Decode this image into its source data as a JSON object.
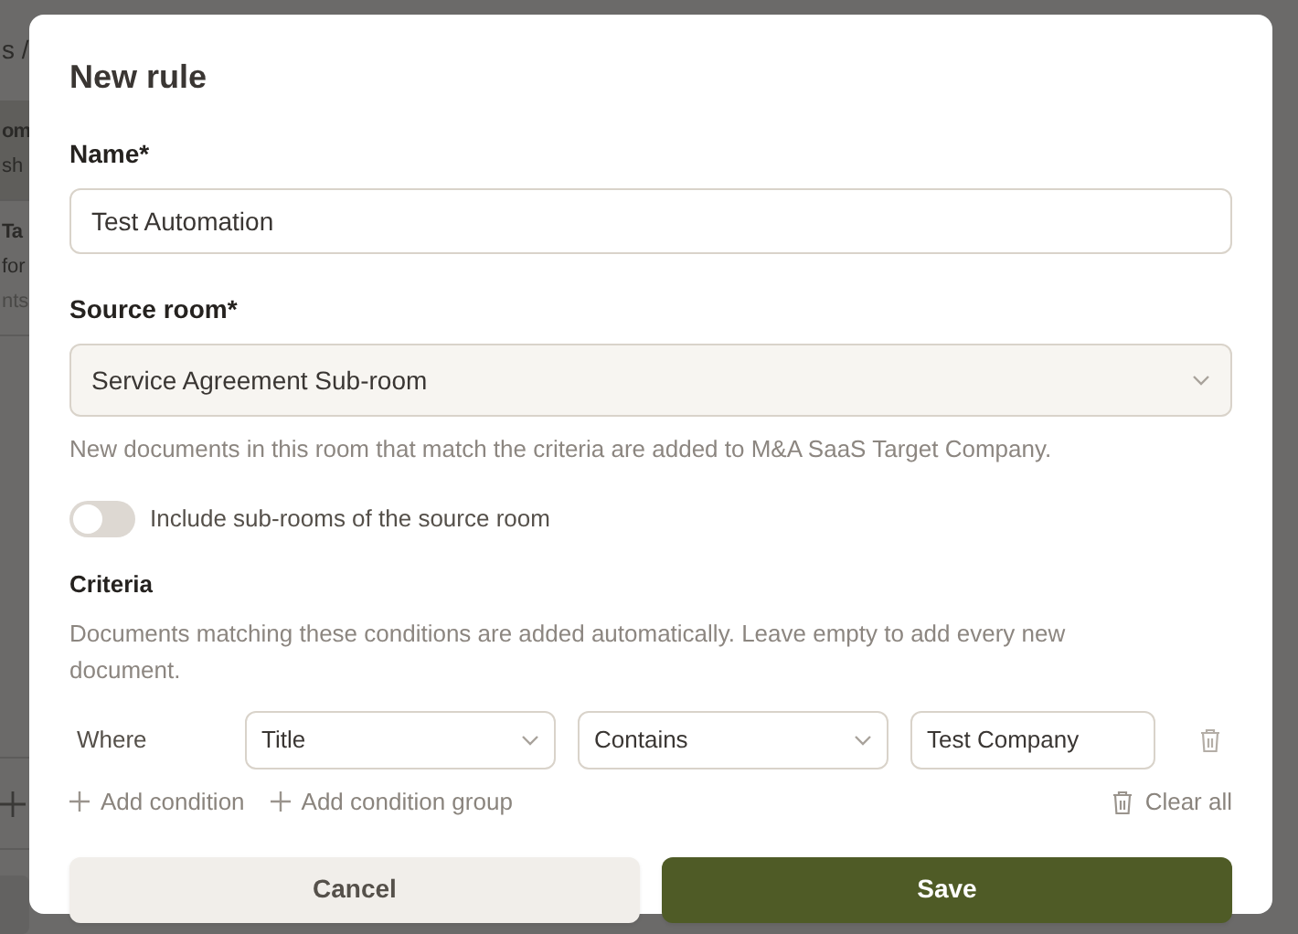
{
  "background": {
    "breadcrumb": "s /",
    "items": [
      {
        "title": "om",
        "subtitle": "sh",
        "selected": true
      },
      {
        "title": "Ta",
        "subtitle": "for",
        "meta": "nts",
        "selected": false
      }
    ]
  },
  "dialog": {
    "title": "New rule",
    "fields": [
      {
        "kind": "text",
        "label": "Name*",
        "value": "Test Automation"
      },
      {
        "kind": "select",
        "label": "Source room*",
        "value": "Service Agreement Sub-room",
        "help": "New documents in this room that match the criteria are added to M&A SaaS Target Company."
      }
    ],
    "toggle": {
      "label": "Include sub-rooms of the source room",
      "on": false
    },
    "criteria": {
      "title": "Criteria",
      "description": "Documents matching these conditions are added automatically. Leave empty to add every new document.",
      "conditions": [
        {
          "prefix": "Where",
          "field": "Title",
          "operator": "Contains",
          "value": "Test Company"
        }
      ],
      "actions": [
        "Add condition",
        "Add condition group"
      ],
      "clear": "Clear all"
    },
    "buttons": [
      {
        "label": "Cancel",
        "kind": "secondary"
      },
      {
        "label": "Save",
        "kind": "primary"
      }
    ]
  }
}
